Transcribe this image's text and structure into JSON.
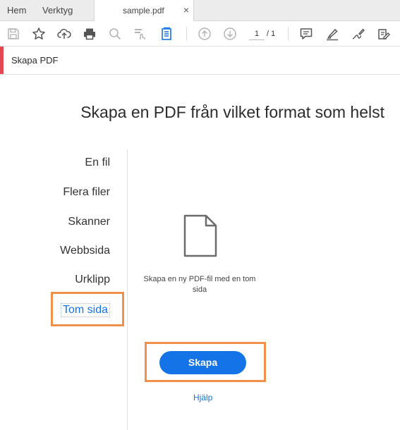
{
  "tabs": {
    "home": "Hem",
    "tools": "Verktyg",
    "document": "sample.pdf",
    "close_glyph": "×"
  },
  "toolbar": {
    "icons": [
      "save-icon",
      "star-icon",
      "cloud-upload-icon",
      "print-icon",
      "search-icon",
      "touch-select-icon",
      "page-text-icon",
      "up-arrow-icon",
      "down-arrow-icon",
      "comment-icon",
      "highlight-icon",
      "sign-icon",
      "fill-sign-icon"
    ],
    "page_current": "1",
    "page_total": "/ 1"
  },
  "panel": {
    "title": "Skapa PDF",
    "accent_color": "#e34850"
  },
  "main": {
    "heading": "Skapa en PDF från vilket format som helst",
    "nav": [
      {
        "label": "En fil"
      },
      {
        "label": "Flera filer"
      },
      {
        "label": "Skanner"
      },
      {
        "label": "Webbsida"
      },
      {
        "label": "Urklipp"
      },
      {
        "label": "Tom sida",
        "selected": true
      }
    ],
    "description": "Skapa en ny PDF-fil med en tom sida",
    "create_button": "Skapa",
    "help_link": "Hjälp",
    "accent_color": "#1473e6",
    "highlight_color": "#f0904a"
  }
}
